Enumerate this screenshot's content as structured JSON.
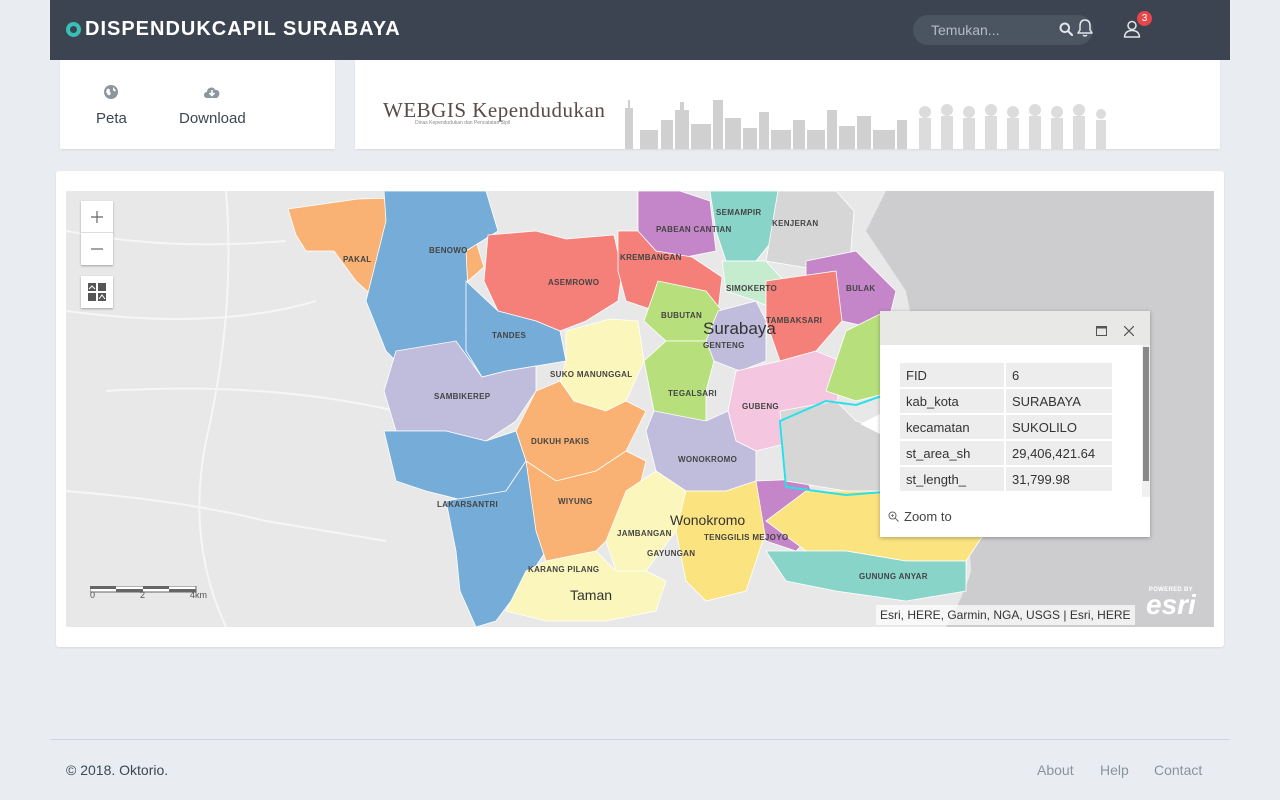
{
  "header": {
    "brand": "DISPENDUKCAPIL SURABAYA",
    "search_placeholder": "Temukan...",
    "notification_count": "3"
  },
  "nav": {
    "items": [
      {
        "label": "Peta",
        "icon": "globe-icon"
      },
      {
        "label": "Download",
        "icon": "cloud-download-icon"
      }
    ]
  },
  "banner": {
    "title": "WEBGIS Kependudukan",
    "subtitle": "Dinas Kependudukan dan Pencatatan Sipil"
  },
  "map": {
    "districts": [
      {
        "name": "PAKAL",
        "color": "#f9b274"
      },
      {
        "name": "BENOWO",
        "color": "#76acd8"
      },
      {
        "name": "ASEMROWO",
        "color": "#f5807a"
      },
      {
        "name": "PABEAN CANTIAN",
        "color": "#f5807a"
      },
      {
        "name": "SEMAMPIR",
        "color": "#88d4c8"
      },
      {
        "name": "KENJERAN",
        "color": "#d6d6d6"
      },
      {
        "name": "KREMBANGAN",
        "color": "#f5807a"
      },
      {
        "name": "SIMOKERTO",
        "color": "#c6ecd0"
      },
      {
        "name": "BULAK",
        "color": "#c486c8"
      },
      {
        "name": "TANDES",
        "color": "#76acd8"
      },
      {
        "name": "BUBUTAN",
        "color": "#b7e07c"
      },
      {
        "name": "TAMBAKSARI",
        "color": "#f5807a"
      },
      {
        "name": "GENTENG",
        "color": "#c0bcdc"
      },
      {
        "name": "SUKO MANUNGGAL",
        "color": "#fbf6bc"
      },
      {
        "name": "SAMBIKEREP",
        "color": "#c0bcdc"
      },
      {
        "name": "TEGALSARI",
        "color": "#b7e07c"
      },
      {
        "name": "GUBENG",
        "color": "#f5c6df"
      },
      {
        "name": "DUKUH PAKIS",
        "color": "#f9b274"
      },
      {
        "name": "WONOKROMO",
        "color": "#c0bcdc"
      },
      {
        "name": "LAKARSANTRI",
        "color": "#76acd8"
      },
      {
        "name": "WIYUNG",
        "color": "#f9b274"
      },
      {
        "name": "JAMBANGAN",
        "color": "#fbf6bc"
      },
      {
        "name": "TENGGILIS MEJOYO",
        "color": "#fbe380"
      },
      {
        "name": "GAYUNGAN",
        "color": "#fbe380"
      },
      {
        "name": "KARANG PILANG",
        "color": "#fbf6bc"
      },
      {
        "name": "GUNUNG ANYAR",
        "color": "#88d4c8"
      }
    ],
    "places": {
      "surabaya": "Surabaya",
      "wonokromo": "Wonokromo",
      "taman": "Taman"
    },
    "scale": {
      "l0": "0",
      "l2": "2",
      "l4": "4km"
    },
    "attribution": "Esri, HERE, Garmin, NGA, USGS | Esri, HERE",
    "esri": {
      "powered": "POWERED BY",
      "logo": "esri"
    }
  },
  "popup": {
    "rows": [
      {
        "key": "FID",
        "value": "6"
      },
      {
        "key": "kab_kota",
        "value": "SURABAYA"
      },
      {
        "key": "kecamatan",
        "value": "SUKOLILO"
      },
      {
        "key": "st_area_sh",
        "value": "29,406,421.64"
      },
      {
        "key": "st_length_",
        "value": "31,799.98"
      }
    ],
    "zoom_to": "Zoom to"
  },
  "footer": {
    "copyright": "© 2018. Oktorio.",
    "links": [
      "About",
      "Help",
      "Contact"
    ]
  },
  "colors": {
    "header_bg": "#3b4450",
    "accent": "#36c0b6",
    "badge": "#e8474a"
  }
}
